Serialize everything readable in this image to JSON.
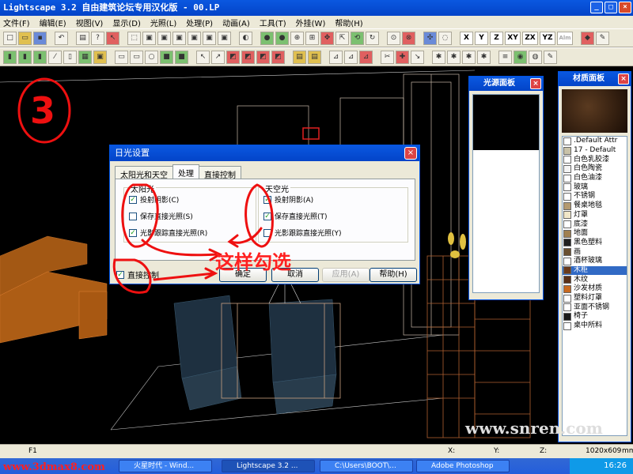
{
  "window": {
    "title": "Lightscape 3.2  自由建筑论坛专用汉化版   - 00.LP",
    "buttons": [
      "_",
      "□",
      "×"
    ]
  },
  "menu": [
    "文件(F)",
    "编辑(E)",
    "视图(V)",
    "显示(D)",
    "光照(L)",
    "处理(P)",
    "动画(A)",
    "工具(T)",
    "外挂(W)",
    "帮助(H)"
  ],
  "toolbar": {
    "axes": [
      "X",
      "Y",
      "Z",
      "XY",
      "ZX",
      "YZ",
      "Alm"
    ]
  },
  "light_panel": {
    "title": "光源面板"
  },
  "material_panel": {
    "title": "材质面板",
    "items": [
      {
        "name": ".Default Attr",
        "color": "#ffffff"
      },
      {
        "name": "17 - Default",
        "color": "#c9c2a8"
      },
      {
        "name": "白色乳胶漆",
        "color": "#ffffff"
      },
      {
        "name": "白色陶瓷",
        "color": "#f4f4f4"
      },
      {
        "name": "白色油漆",
        "color": "#ffffff"
      },
      {
        "name": "玻璃",
        "color": "#ffffff"
      },
      {
        "name": "不锈钢",
        "color": "#ffffff"
      },
      {
        "name": "餐桌地毯",
        "color": "#b49a70"
      },
      {
        "name": "灯罩",
        "color": "#f0e6c8"
      },
      {
        "name": "底漆",
        "color": "#ffffff"
      },
      {
        "name": "地面",
        "color": "#a08050"
      },
      {
        "name": "黑色塑料",
        "color": "#202020"
      },
      {
        "name": "画",
        "color": "#6a5030"
      },
      {
        "name": "酒杯玻璃",
        "color": "#ffffff"
      },
      {
        "name": "木柜",
        "color": "#6a3a1a"
      },
      {
        "name": "木纹",
        "color": "#5a3018"
      },
      {
        "name": "沙发材质",
        "color": "#c86a20"
      },
      {
        "name": "塑料灯罩",
        "color": "#ffffff"
      },
      {
        "name": "亚面不锈钢",
        "color": "#ffffff"
      },
      {
        "name": "椅子",
        "color": "#1a1a1a"
      },
      {
        "name": "桌中所料",
        "color": "#ffffff"
      }
    ],
    "selected_index": 14
  },
  "dialog": {
    "title": "日光设置",
    "tabs": [
      "太阳光和天空",
      "处理",
      "直接控制"
    ],
    "active_tab": 1,
    "sun_group": {
      "label": "太阳光",
      "options": [
        {
          "label": "投射阴影(C)",
          "checked": true
        },
        {
          "label": "保存直接光照(S)",
          "checked": false
        },
        {
          "label": "光影跟踪直接光照(R)",
          "checked": true
        }
      ]
    },
    "sky_group": {
      "label": "天空光",
      "options": [
        {
          "label": "投射阴影(A)",
          "checked": true
        },
        {
          "label": "保存直接光照(T)",
          "checked": true
        },
        {
          "label": "光影跟踪直接光照(Y)",
          "checked": false
        }
      ]
    },
    "direct_control": {
      "label": "直接控制",
      "checked": true
    },
    "buttons": {
      "ok": "确定",
      "cancel": "取消",
      "apply": "应用(A)",
      "help": "帮助(H)"
    }
  },
  "annotations": {
    "number": "3",
    "note": "这样勾选"
  },
  "watermark": "www.snren.com",
  "site_mark": "www.3dmax8.com",
  "statusbar": {
    "left": "F1",
    "x": "X:",
    "y": "Y:",
    "z": "Z:",
    "res": "1020x609",
    "unit": "mm"
  },
  "taskbar": {
    "tasks": [
      "火星时代 - Wind...",
      "Lightscape 3.2 ...",
      "C:\\Users\\BOOT\\...",
      "Adobe Photoshop"
    ],
    "active_index": 1,
    "clock": "16:26"
  }
}
